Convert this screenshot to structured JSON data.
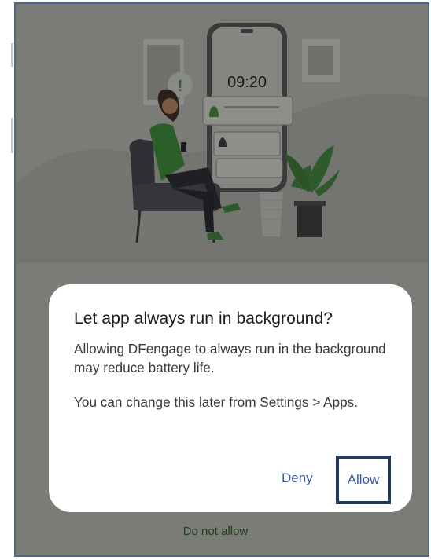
{
  "illustration": {
    "phone_time": "09:20",
    "alert_symbol": "!"
  },
  "dialog": {
    "title": "Let app always run in background?",
    "body_1": "Allowing DFengage to always run in the background may reduce battery life.",
    "body_2": "You can change this later from Settings > Apps.",
    "deny_label": "Deny",
    "allow_label": "Allow"
  },
  "footer": {
    "do_not_allow_label": "Do not allow"
  },
  "colors": {
    "scrim": "#7b7b78",
    "dialog_bg": "#ffffff",
    "accent": "#3a5aa6",
    "highlight_border": "#25395e",
    "plant_green": "#2e5a2b"
  }
}
